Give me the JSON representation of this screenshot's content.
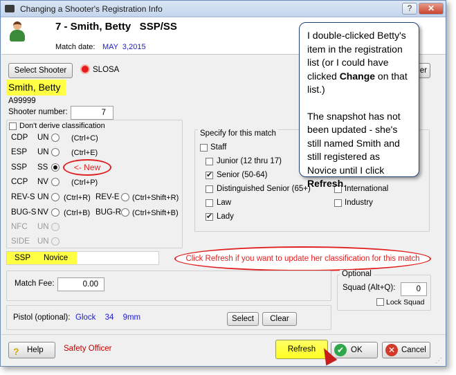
{
  "window": {
    "title": "Changing a Shooter's Registration Info",
    "help_glyph": "?",
    "close_glyph": "✕"
  },
  "header": {
    "shooter_heading": "7 - Smith, Betty   SSP/SS",
    "match_date_label": "Match date:",
    "match_date_value": "MAY  3,2015"
  },
  "toolbar": {
    "select_shooter_label": "Select Shooter",
    "slosa_label": "SLOSA",
    "change_button_fragment": "er"
  },
  "shooter": {
    "name": "Smith, Betty",
    "id": "A99999",
    "number_label": "Shooter number:",
    "number": "7"
  },
  "classification": {
    "dont_derive_label": "Don't derive classification",
    "rows_left": [
      {
        "division": "CDP",
        "class": "UN",
        "hotkey": "(Ctrl+C)",
        "selected": false,
        "disabled": false
      },
      {
        "division": "ESP",
        "class": "UN",
        "hotkey": "(Ctrl+E)",
        "selected": false,
        "disabled": false
      },
      {
        "division": "SSP",
        "class": "SS",
        "hotkey": "",
        "selected": true,
        "disabled": false
      },
      {
        "division": "CCP",
        "class": "NV",
        "hotkey": "(Ctrl+P)",
        "selected": false,
        "disabled": false
      },
      {
        "division": "REV-S",
        "class": "UN",
        "hotkey": "(Ctrl+R)",
        "selected": false,
        "disabled": false
      },
      {
        "division": "BUG-S",
        "class": "NV",
        "hotkey": "(Ctrl+B)",
        "selected": false,
        "disabled": false
      },
      {
        "division": "NFC",
        "class": "UN",
        "hotkey": "",
        "selected": false,
        "disabled": true
      },
      {
        "division": "SIDE",
        "class": "UN",
        "hotkey": "",
        "selected": false,
        "disabled": true
      }
    ],
    "rows_right": [
      {
        "division": "REV-E",
        "hotkey": "(Ctrl+Shift+R)"
      },
      {
        "division": "BUG-R",
        "hotkey": "(Ctrl+Shift+B)"
      }
    ],
    "new_callout": "<- New"
  },
  "class_summary": {
    "division": "SSP",
    "level": "Novice"
  },
  "refresh_callout": "Click Refresh if you want to update her classification for this match",
  "specify": {
    "title": "Specify for this match",
    "staff_label": "Staff",
    "junior_label": "Junior (12 thru 17)",
    "senior_label": "Senior (50-64)",
    "dist_senior_label": "Distinguished Senior (65+)",
    "law_label": "Law",
    "lady_label": "Lady",
    "international_label": "International",
    "industry_label": "Industry",
    "checked": {
      "staff": false,
      "junior": false,
      "senior": true,
      "dist_senior": false,
      "law": false,
      "lady": true,
      "international": false,
      "industry": false
    }
  },
  "fee": {
    "label": "Match Fee:",
    "value": "0.00"
  },
  "optional": {
    "title": "Optional",
    "squad_label": "Squad (Alt+Q):",
    "squad_value": "0",
    "lock_squad_label": "Lock Squad",
    "lock_squad_checked": false
  },
  "pistol": {
    "label": "Pistol (optional):",
    "value": "Glock 34 9mm",
    "select_label": "Select",
    "clear_label": "Clear"
  },
  "footer": {
    "help_label": "Help",
    "safety_officer": "Safety Officer",
    "refresh_label": "Refresh",
    "ok_label": "OK",
    "cancel_label": "Cancel"
  },
  "note": {
    "paragraph1_prefix": "I double-clicked Betty's item in the registration list (or I could have clicked ",
    "paragraph1_bold": "Change",
    "paragraph1_suffix": " on that list.)",
    "paragraph2_prefix": "The snapshot has not been updated - she's still named Smith and still registered as Novice until I click ",
    "paragraph2_bold": "Refresh",
    "paragraph2_suffix": "."
  },
  "colors": {
    "highlight": "#ffff44",
    "callout_red": "#e02020",
    "link_blue": "#1a1ad0",
    "safety_red": "#c00000"
  }
}
